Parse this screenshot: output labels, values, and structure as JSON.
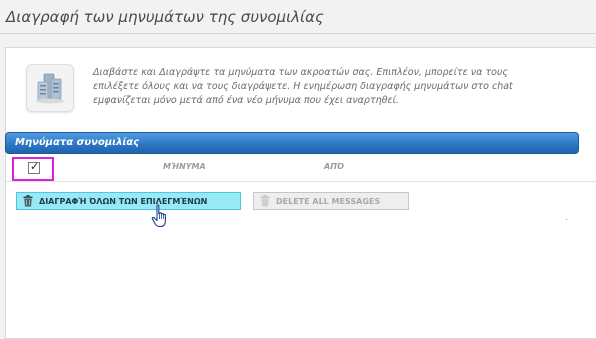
{
  "page": {
    "title": "Διαγραφή των μηνυμάτων της συνομιλίας"
  },
  "info": {
    "icon": "chat-messages-icon",
    "line1": "Διαβάστε και Διαγράψτε τα μηνύματα των ακροατών σας. Επιπλέον, μπορείτε να τους",
    "line2": "επιλέξετε όλους και να τους διαγράψετε. Η ενημέρωση διαγραφής μηνυμάτων στο chat",
    "line3": "εμφανίζεται μόνο μετά από ένα νέο μήνυμα που έχει αναρτηθεί."
  },
  "section": {
    "title": "Μηνύματα συνομιλίας"
  },
  "table": {
    "columns": [
      "ΜΉΝΥΜΑ",
      "ΑΠΌ"
    ],
    "select_all_checked": true
  },
  "actions": {
    "delete_selected_label": "ΔΙΑΓΡΑΦΉ ΌΛΩΝ ΤΩΝ ΕΠΙΛΕΓΜΈΝΩΝ",
    "delete_all_label": "DELETE ALL MESSAGES"
  },
  "colors": {
    "header_blue": "#2f78c6",
    "selected_button": "#97e9f5",
    "highlight_magenta": "#e020d8"
  }
}
